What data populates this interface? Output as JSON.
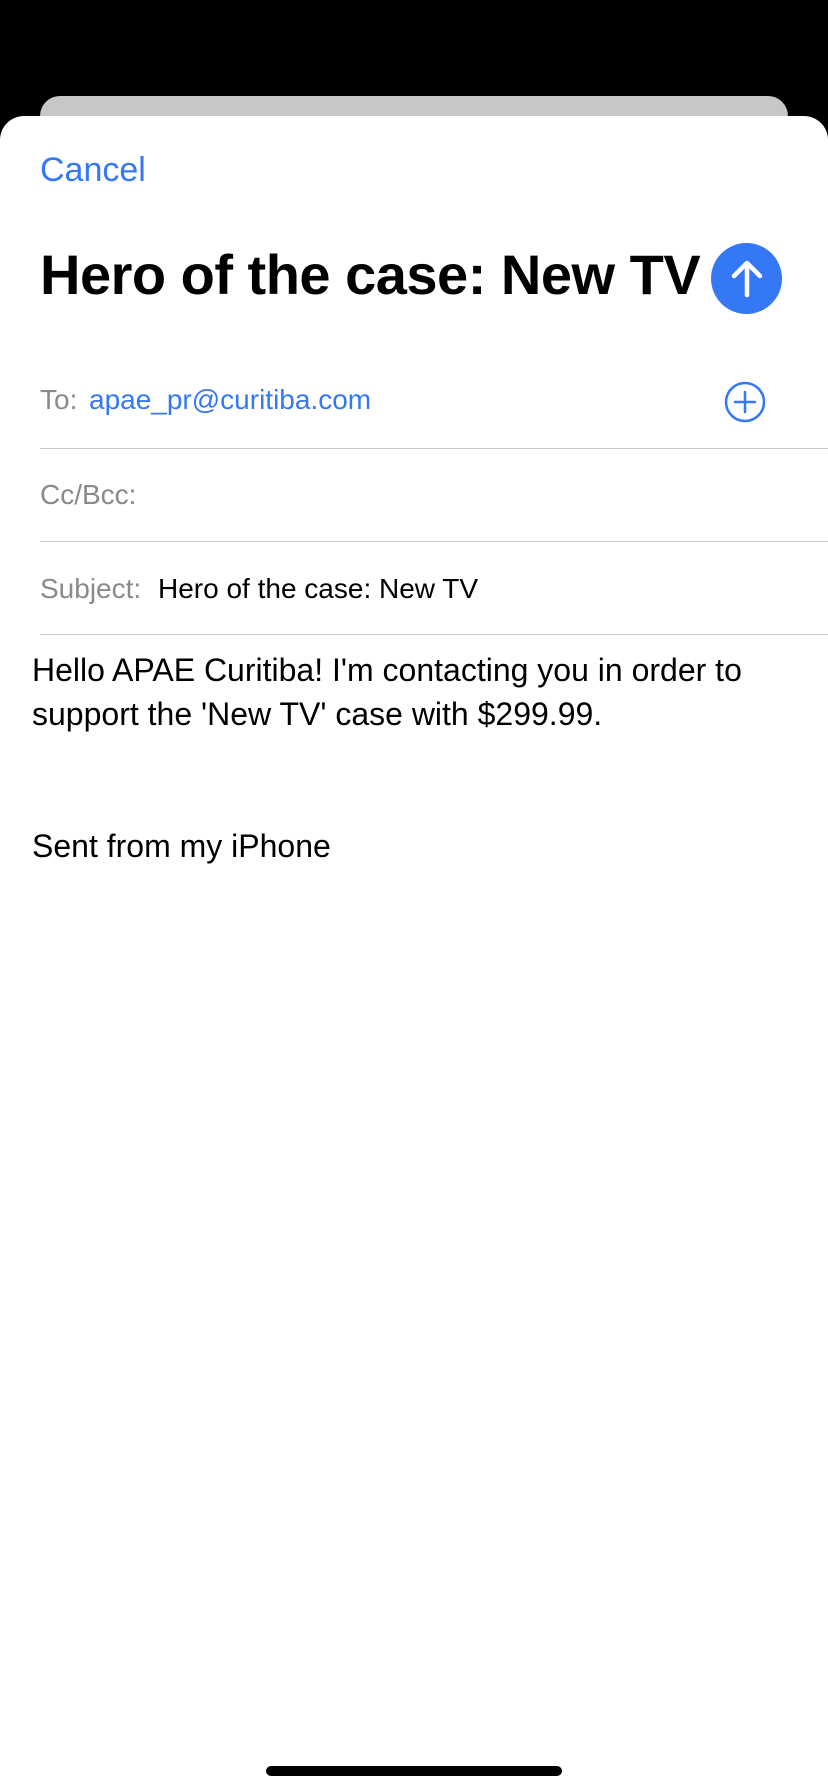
{
  "compose": {
    "cancel_label": "Cancel",
    "title": "Hero of the case: New TV",
    "to_label": "To:",
    "to_value": "apae_pr@curitiba.com",
    "cc_label": "Cc/Bcc:",
    "subject_label": "Subject:",
    "subject_value": "Hero of the case: New TV",
    "body": "Hello APAE Curitiba! I'm contacting you in order to support the 'New TV' case with $299.99.",
    "signature": "Sent from my iPhone"
  },
  "icons": {
    "send": "arrow-up-icon",
    "add_recipient": "plus-circle-icon"
  },
  "colors": {
    "accent": "#3478f6",
    "label_gray": "#8a8a8e",
    "separator": "#c8c8cc"
  }
}
